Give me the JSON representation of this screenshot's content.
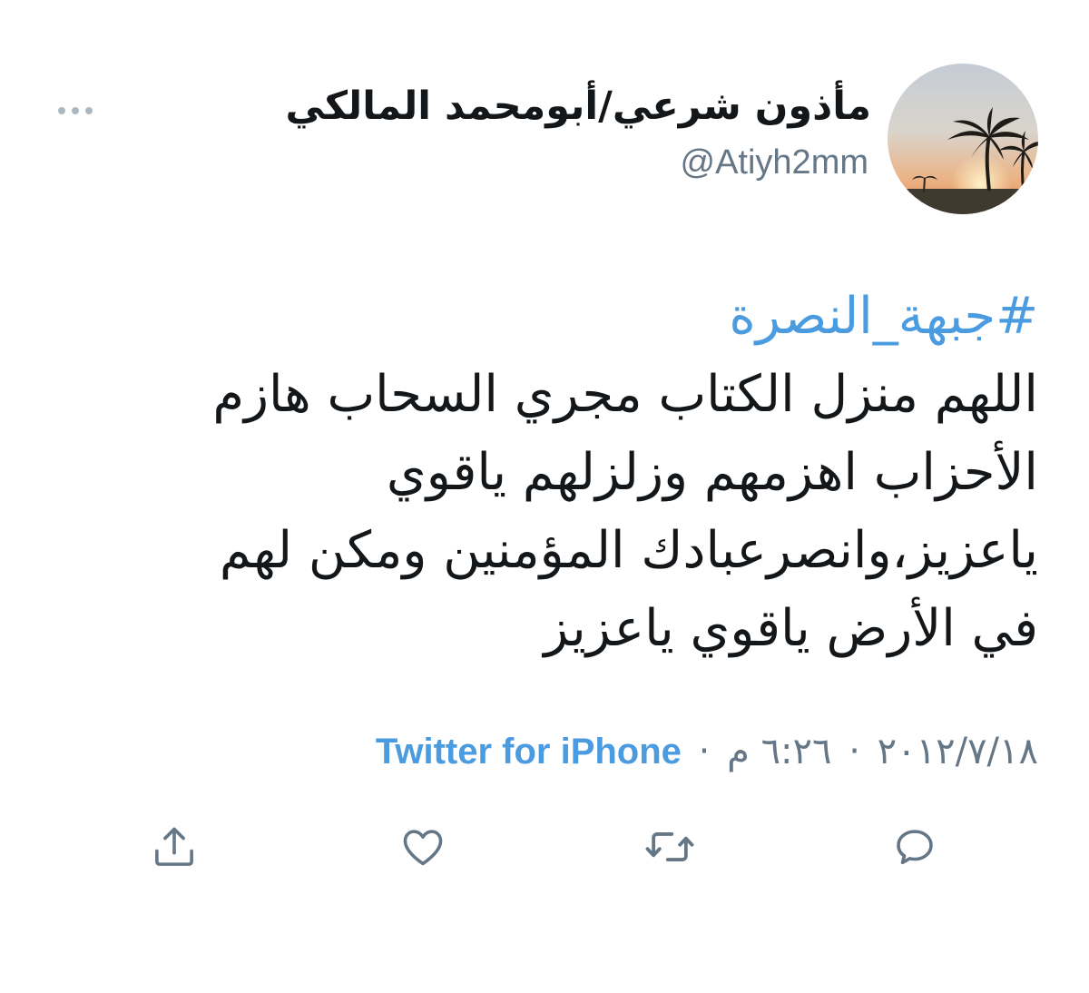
{
  "author": {
    "display_name": "مأذون شرعي/أبومحمد المالكي",
    "handle": "@Atiyh2mm",
    "avatar_icon": "palm-sunset-avatar"
  },
  "tweet": {
    "hashtag": "#جبهة_النصرة",
    "lines": [
      " اللهم منزل الكتاب مجري السحاب هازم",
      "الأحزاب اهزمهم وزلزلهم ياقوي",
      "ياعزيز،وانصرعبادك المؤمنين ومكن لهم",
      "في الأرض ياقوي ياعزيز"
    ]
  },
  "meta": {
    "date": "٢٠١٢/٧/١٨",
    "separator": "·",
    "time": "٦:٢٦ م",
    "source": "Twitter for iPhone"
  },
  "actions": {
    "reply_icon": "speech-bubble-icon",
    "retweet_icon": "retweet-icon",
    "like_icon": "heart-icon",
    "share_icon": "share-icon"
  },
  "colors": {
    "link": "#4a9be0",
    "secondary_text": "#657786",
    "icon": "#657786",
    "primary_text": "#14171a"
  }
}
